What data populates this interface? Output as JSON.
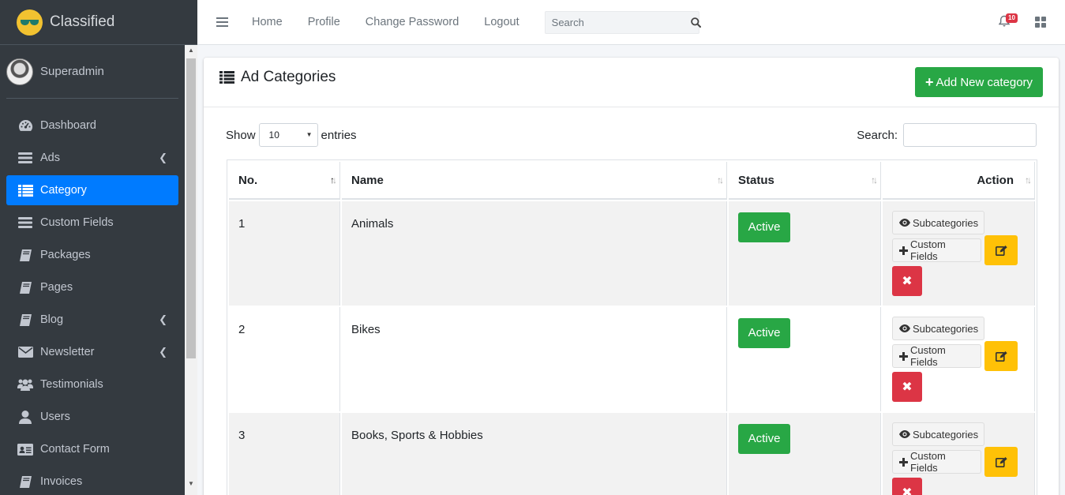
{
  "brand": {
    "name": "Classified"
  },
  "user": {
    "name": "Superadmin"
  },
  "sidebar": {
    "items": [
      {
        "label": "Dashboard",
        "icon": "dashboard-icon"
      },
      {
        "label": "Ads",
        "icon": "bars-icon",
        "has_children": true
      },
      {
        "label": "Category",
        "icon": "list-icon",
        "active": true
      },
      {
        "label": "Custom Fields",
        "icon": "bars-icon"
      },
      {
        "label": "Packages",
        "icon": "book-icon"
      },
      {
        "label": "Pages",
        "icon": "book-icon"
      },
      {
        "label": "Blog",
        "icon": "book-icon",
        "has_children": true
      },
      {
        "label": "Newsletter",
        "icon": "envelope-icon",
        "has_children": true
      },
      {
        "label": "Testimonials",
        "icon": "users-icon"
      },
      {
        "label": "Users",
        "icon": "user-icon"
      },
      {
        "label": "Contact Form",
        "icon": "address-card-icon"
      },
      {
        "label": "Invoices",
        "icon": "book-icon"
      }
    ]
  },
  "topbar": {
    "links": [
      "Home",
      "Profile",
      "Change Password",
      "Logout"
    ],
    "search_placeholder": "Search",
    "notification_count": "10"
  },
  "card": {
    "title": "Ad Categories",
    "add_button": "Add New category"
  },
  "table_controls": {
    "show_label": "Show",
    "entries_value": "10",
    "entries_label": "entries",
    "search_label": "Search:"
  },
  "table": {
    "columns": [
      "No.",
      "Name",
      "Status",
      "Action"
    ],
    "rows": [
      {
        "no": "1",
        "name": "Animals",
        "status": "Active"
      },
      {
        "no": "2",
        "name": "Bikes",
        "status": "Active"
      },
      {
        "no": "3",
        "name": "Books, Sports & Hobbies",
        "status": "Active"
      }
    ],
    "subcategories_label": "Subcategories",
    "custom_fields_label": "Custom Fields"
  },
  "colors": {
    "sidebar_bg": "#343a40",
    "active": "#007bff",
    "success": "#28a745",
    "warning": "#ffc107",
    "danger": "#dc3545"
  }
}
